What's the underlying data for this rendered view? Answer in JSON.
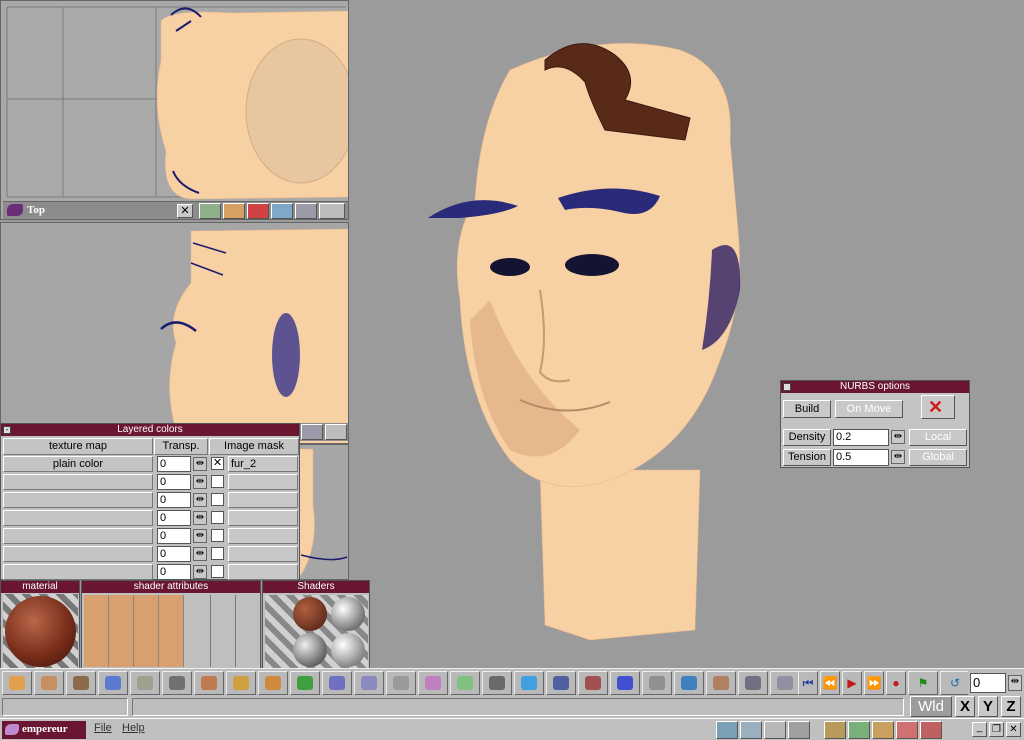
{
  "viewports": {
    "top_label": "Top"
  },
  "layered_colors": {
    "title": "Layered colors",
    "col_texture": "texture map",
    "col_transp": "Transp.",
    "col_mask": "Image mask",
    "rows": [
      {
        "texture": "plain color",
        "transp": "0",
        "checked": true,
        "mask": "fur_2"
      },
      {
        "texture": "",
        "transp": "0",
        "checked": false,
        "mask": ""
      },
      {
        "texture": "",
        "transp": "0",
        "checked": false,
        "mask": ""
      },
      {
        "texture": "",
        "transp": "0",
        "checked": false,
        "mask": ""
      },
      {
        "texture": "",
        "transp": "0",
        "checked": false,
        "mask": ""
      },
      {
        "texture": "",
        "transp": "0",
        "checked": false,
        "mask": ""
      },
      {
        "texture": "",
        "transp": "0",
        "checked": false,
        "mask": ""
      }
    ]
  },
  "material_panel": {
    "title": "material"
  },
  "shader_attributes_panel": {
    "title": "shader attributes"
  },
  "shaders_panel": {
    "title": "Shaders"
  },
  "nurbs": {
    "title": "NURBS options",
    "build_label": "Build",
    "on_move_label": "On Move",
    "density_label": "Density",
    "density_value": "0.2",
    "tension_label": "Tension",
    "tension_value": "0.5",
    "local_label": "Local",
    "global_label": "Global"
  },
  "toolbar": {
    "frame_value": "0",
    "icons": [
      "cube-gradient-icon",
      "box-icon",
      "dog-icon",
      "pointer-icon",
      "scale-icon",
      "rotate-icon",
      "mesh-icon",
      "extrude-icon",
      "lathe-icon",
      "sphere-icon",
      "cylinder-icon",
      "molecule-icon",
      "path-icon",
      "cone-icon",
      "plane-icon",
      "table-icon",
      "cube-blue-icon",
      "figure-icon",
      "axes-icon",
      "grid-icon",
      "torus-icon",
      "3d-icon",
      "deform-icon",
      "curve-icon",
      "join-icon"
    ]
  },
  "playback": {
    "icons": [
      "first-frame-icon",
      "rewind-icon",
      "play-icon",
      "fast-forward-icon",
      "record-icon",
      "key-icon",
      "loop-icon"
    ]
  },
  "coords": {
    "wld_label": "Wld",
    "x_label": "X",
    "y_label": "Y",
    "z_label": "Z"
  },
  "taskbar": {
    "app_name": "empereur",
    "menu_file": "File",
    "menu_help": "Help"
  }
}
